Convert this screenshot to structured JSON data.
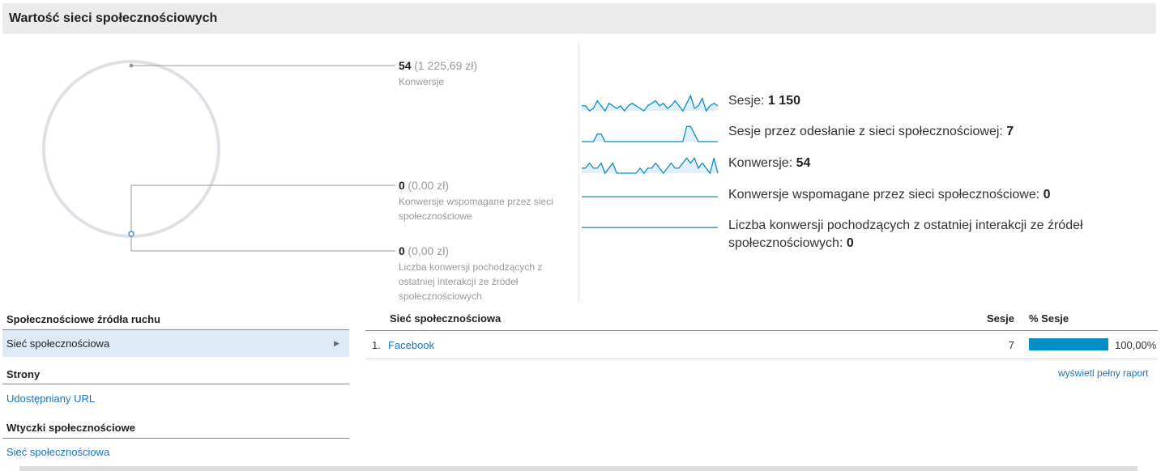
{
  "page_title": "Wartość sieci społecznościowych",
  "diagram": {
    "metrics": [
      {
        "value": "54",
        "money": "(1 225,69 zł)",
        "label": "Konwersje"
      },
      {
        "value": "0",
        "money": "(0,00 zł)",
        "label_lines": [
          "Konwersje wspomagane przez sieci",
          "społecznościowe"
        ]
      },
      {
        "value": "0",
        "money": "(0,00 zł)",
        "label_lines": [
          "Liczba konwersji pochodzących z",
          "ostatniej interakcji ze źródeł",
          "społecznościowych"
        ]
      }
    ]
  },
  "sparklines": [
    {
      "label": "Sesje: ",
      "value": "1 150",
      "series": [
        12,
        12,
        10,
        11,
        14,
        12,
        10,
        13,
        12,
        11,
        12,
        10,
        12,
        13,
        12,
        11,
        10,
        12,
        13,
        14,
        12,
        13,
        11,
        12,
        14,
        12,
        10,
        13,
        16,
        11,
        12,
        15,
        10,
        12,
        13,
        12
      ]
    },
    {
      "label": "Sesje przez odesłanie z sieci społecznościowej: ",
      "value": "7",
      "series": [
        0,
        0,
        0,
        0,
        1,
        1,
        0,
        0,
        0,
        0,
        0,
        0,
        0,
        0,
        0,
        0,
        0,
        0,
        0,
        0,
        0,
        0,
        0,
        0,
        0,
        0,
        0,
        2,
        2,
        1,
        0,
        0,
        0,
        0,
        0,
        0
      ]
    },
    {
      "label": "Konwersje: ",
      "value": "54",
      "series": [
        2,
        2,
        3,
        2,
        2,
        3,
        1,
        2,
        3,
        1,
        1,
        1,
        1,
        1,
        1,
        2,
        1,
        2,
        2,
        3,
        2,
        1,
        2,
        3,
        2,
        2,
        3,
        4,
        3,
        4,
        2,
        3,
        2,
        1,
        4,
        1
      ]
    },
    {
      "label": "Konwersje wspomagane przez sieci społecznościowe: ",
      "value": "0",
      "series": [
        0,
        0
      ]
    },
    {
      "label_lines": [
        "Liczba konwersji pochodzących z ostatniej interakcji ze źródeł",
        "społecznościowych: "
      ],
      "value": "0",
      "series": [
        0,
        0
      ]
    }
  ],
  "left_nav": {
    "sections": [
      {
        "title": "Społecznościowe źródła ruchu",
        "items": [
          {
            "label": "Sieć społecznościowa",
            "active": true
          }
        ]
      },
      {
        "title": "Strony",
        "items": [
          {
            "label": "Udostępniany URL",
            "active": false
          }
        ]
      },
      {
        "title": "Wtyczki społecznościowe",
        "items": [
          {
            "label": "Sieć społecznościowa",
            "active": false
          }
        ]
      }
    ],
    "arrow_icon": "triangle-right-icon"
  },
  "table": {
    "headers": {
      "network": "Sieć społecznościowa",
      "sessions": "Sesje",
      "pct_sessions": "% Sesje"
    },
    "rows": [
      {
        "index": "1.",
        "name": "Facebook",
        "sessions": "7",
        "pct": "100,00%",
        "pct_fill": 1.0
      }
    ],
    "full_report": "wyświetl pełny raport"
  },
  "colors": {
    "accent": "#058dc7",
    "link": "#1a73c4",
    "active_bg": "#deebf6",
    "spark_fill": "#e2eff8"
  }
}
